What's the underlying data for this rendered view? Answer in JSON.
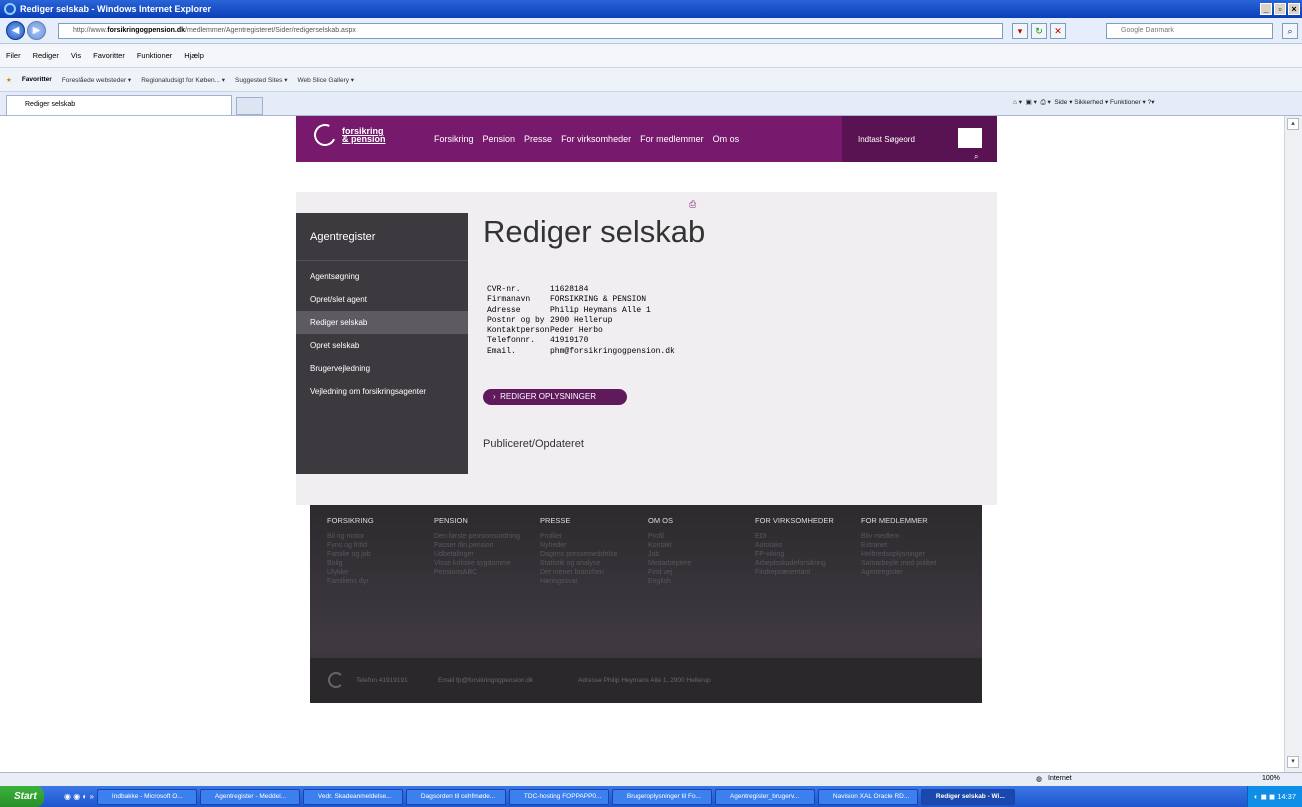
{
  "window": {
    "title": "Rediger selskab - Windows Internet Explorer"
  },
  "browser": {
    "address": "http://www.forsikringogpension.dk/medlemmer/Agentregisteret/Sider/redigerselskab.aspx",
    "address_domain": "forsikringogpension.dk",
    "address_prefix": "http://www.",
    "address_suffix": "/medlemmer/Agentregisteret/Sider/redigerselskab.aspx",
    "search_placeholder": "Google Danmark",
    "menu": [
      "Filer",
      "Rediger",
      "Vis",
      "Favoritter",
      "Funktioner",
      "Hjælp"
    ],
    "favorites_label": "Favoritter",
    "favorites": [
      "Foreslåede websteder ▾",
      "Regionaludsigt for Køben... ▾",
      "Suggested Sites ▾",
      "Web Slice Gallery ▾"
    ],
    "tab_title": "Rediger selskab",
    "commands": "Side ▾  Sikkerhed ▾  Funktioner ▾",
    "status_zone": "Internet",
    "zoom": "100%"
  },
  "site": {
    "logo_line1": "forsikring",
    "logo_line2": "& pension",
    "nav": [
      "Forsikring",
      "Pension",
      "Presse",
      "For virksomheder",
      "For medlemmer",
      "Om os"
    ],
    "search_placeholder": "Indtast Søgeord"
  },
  "sidebar": {
    "heading": "Agentregister",
    "items": [
      "Agentsøgning",
      "Opret/slet agent",
      "Rediger selskab",
      "Opret selskab",
      "Brugervejledning",
      "Vejledning om forsikringsagenter"
    ],
    "active_index": 2
  },
  "main": {
    "title": "Rediger selskab",
    "fields": [
      {
        "label": "CVR-nr.",
        "value": "11628184"
      },
      {
        "label": "Firmanavn",
        "value": "FORSIKRING & PENSION"
      },
      {
        "label": "Adresse",
        "value": "Philip Heymans Alle 1"
      },
      {
        "label": "Postnr og by",
        "value": "2900 Hellerup"
      },
      {
        "label": "Kontaktperson",
        "value": "Peder Herbo"
      },
      {
        "label": "Telefonnr.",
        "value": "41919170"
      },
      {
        "label": "Email.",
        "value": "phm@forsikringogpension.dk"
      }
    ],
    "edit_button": "REDIGER OPLYSNINGER",
    "published_label": "Publiceret/Opdateret"
  },
  "footer": {
    "columns": [
      {
        "heading": "FORSIKRING",
        "links": [
          "Bil og motor",
          "Fyns og fritid",
          "Familie og job",
          "Bolig",
          "Ulykke",
          "Familiens dyr"
        ]
      },
      {
        "heading": "PENSION",
        "links": [
          "Den første pensionsordning",
          "Passer din pension",
          "Udbetalinger",
          "Visse kritiske sygdomme",
          "PensionsABC"
        ]
      },
      {
        "heading": "PRESSE",
        "links": [
          "Profiler",
          "Nyheder",
          "Dagens pressemeddelse",
          "Statistik og analyse",
          "Det mener branchen",
          "Høringssvar"
        ]
      },
      {
        "heading": "OM OS",
        "links": [
          "Profil",
          "Kontakt",
          "Job",
          "Medarbejdere",
          "Find vej",
          "English"
        ]
      },
      {
        "heading": "FOR VIRKSOMHEDER",
        "links": [
          "EDI",
          "Autotaks",
          "FP-viking",
          "Arbejdsskadeforsikring",
          "Findrepræsentant"
        ]
      },
      {
        "heading": "FOR MEDLEMMER",
        "links": [
          "Bliv medlem",
          "Extranet",
          "Helbredsoplysninger",
          "Samarbejde med politiet",
          "Agentregister"
        ]
      }
    ],
    "phone": "Telefon 41919191",
    "email": "Email fp@forsikringogpension.dk",
    "address": "Adresse Philip Heymans Allé 1, 2900 Hellerup"
  },
  "taskbar": {
    "start": "Start",
    "tasks": [
      "Indbakke - Microsoft O...",
      "Agentregister - Meddel...",
      "Vedr. Skadeanmeldelse...",
      "Dagsorden til cehfmøde...",
      "TDC-hosting FOPPAPP0...",
      "Brugeroplysninger til Fo...",
      "Agentregister_brugerv...",
      "Navision XAL Oracle RD...",
      "Rediger selskab - Wi..."
    ],
    "active_task": 8,
    "clock": "14:37"
  }
}
